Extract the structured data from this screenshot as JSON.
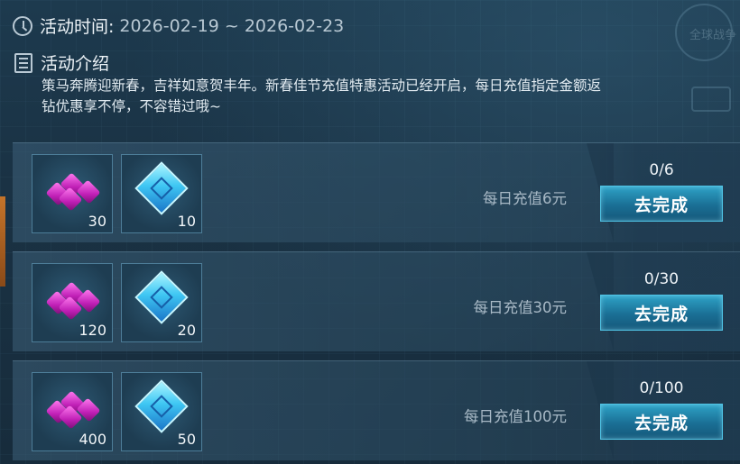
{
  "activity": {
    "time_label": "活动时间:",
    "time_value": "2026-02-19 ~ 2026-02-23",
    "intro_label": "活动介绍",
    "intro_text": "策马奔腾迎新春，吉祥如意贺丰年。新春佳节充值特惠活动已经开启，每日充值指定金额返钻优惠享不停，不容错过哦~"
  },
  "background": {
    "corner_text": "全球战争"
  },
  "tasks": [
    {
      "rewards": [
        {
          "icon": "pink-gem-icon",
          "count": "30"
        },
        {
          "icon": "blue-crystal-icon",
          "count": "10"
        }
      ],
      "desc": "每日充值6元",
      "progress": "0/6",
      "button": "去完成"
    },
    {
      "rewards": [
        {
          "icon": "pink-gem-icon",
          "count": "120"
        },
        {
          "icon": "blue-crystal-icon",
          "count": "20"
        }
      ],
      "desc": "每日充值30元",
      "progress": "0/30",
      "button": "去完成"
    },
    {
      "rewards": [
        {
          "icon": "pink-gem-icon",
          "count": "400"
        },
        {
          "icon": "blue-crystal-icon",
          "count": "50"
        }
      ],
      "desc": "每日充值100元",
      "progress": "0/100",
      "button": "去完成"
    }
  ]
}
